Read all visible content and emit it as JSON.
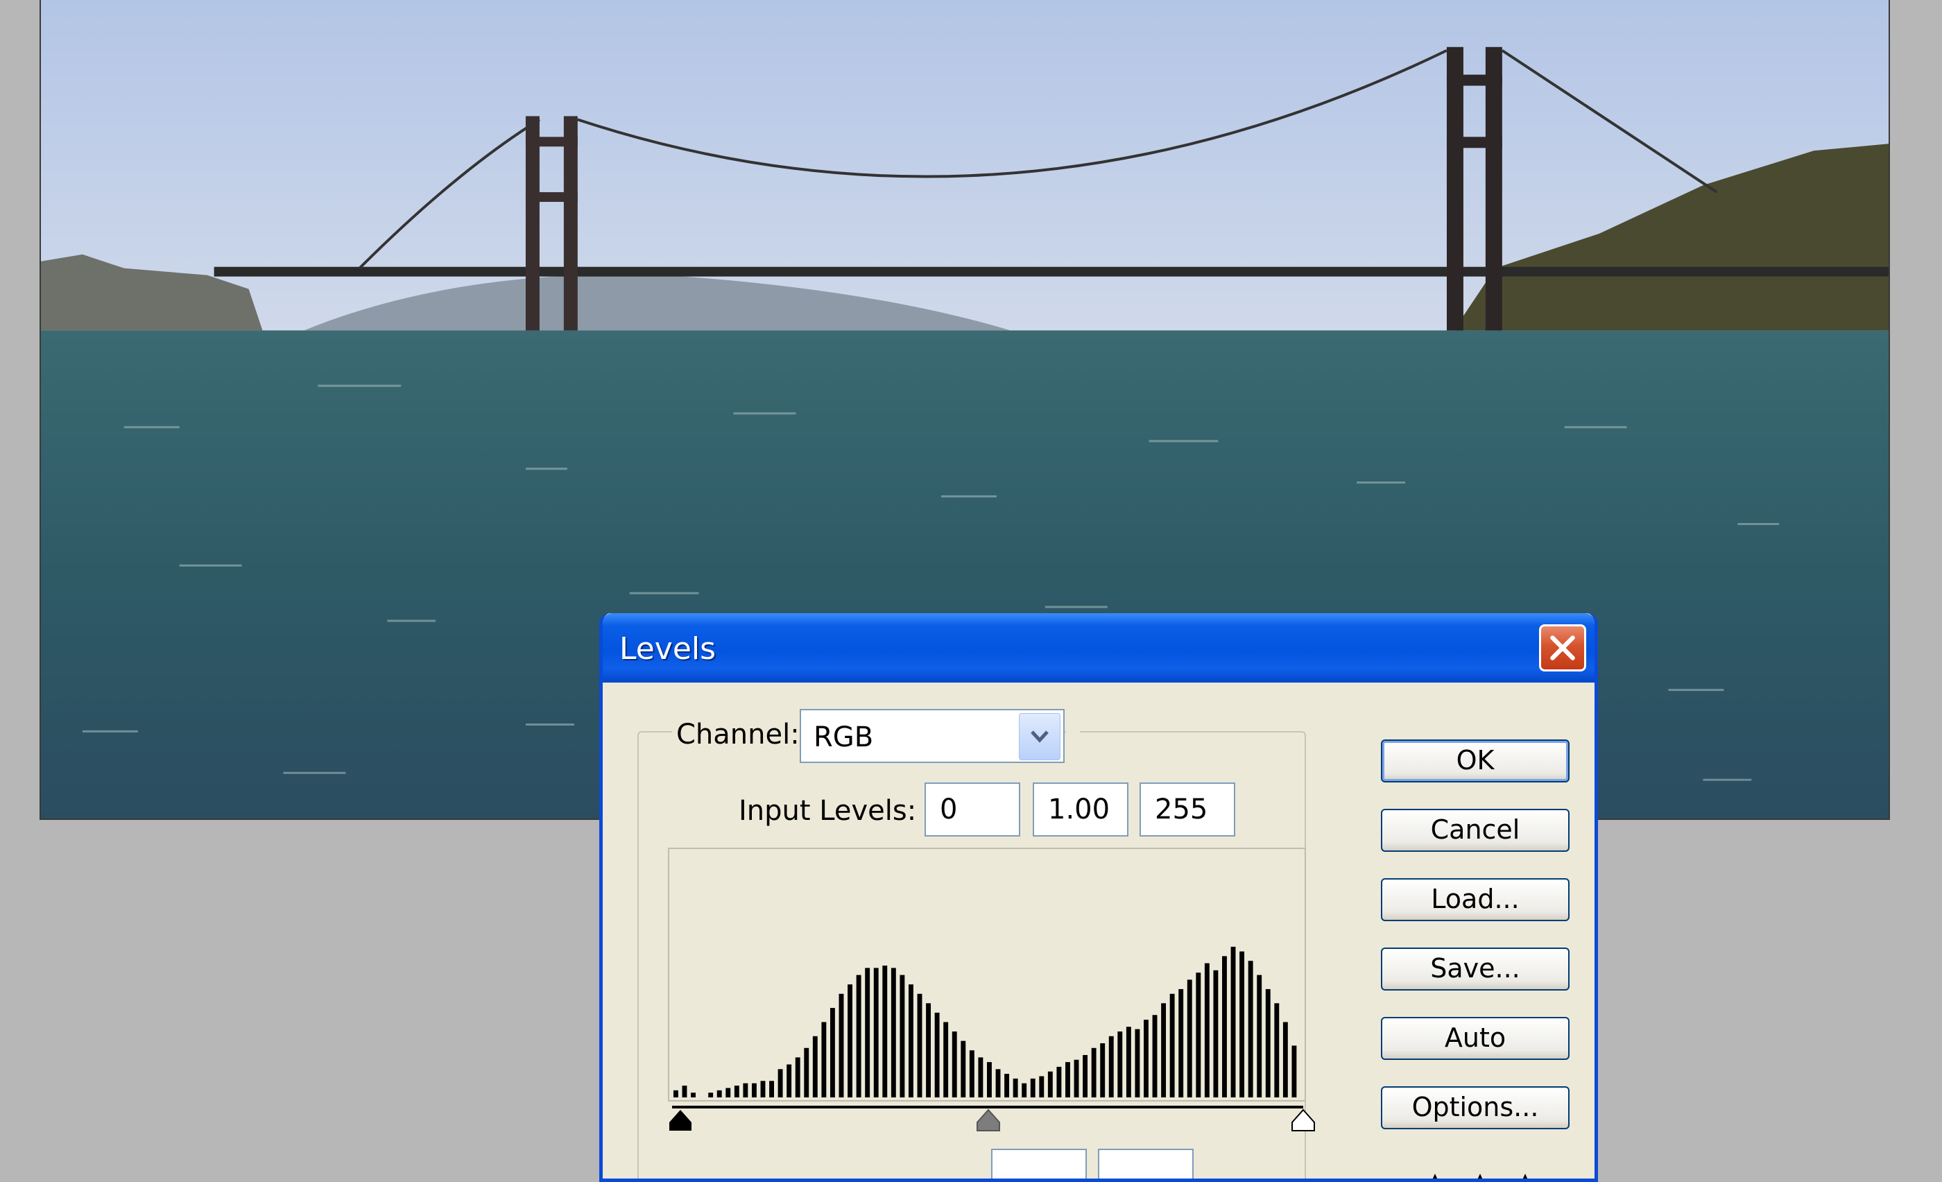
{
  "background_image": {
    "description_icon": "golden-gate-bridge-photo"
  },
  "dialog": {
    "title": "Levels",
    "channel": {
      "label": "Channel:",
      "value": "RGB"
    },
    "input_levels": {
      "label": "Input Levels:",
      "black": "0",
      "gamma": "1.00",
      "white": "255"
    },
    "buttons": {
      "ok": "OK",
      "cancel": "Cancel",
      "load": "Load...",
      "save": "Save...",
      "auto": "Auto",
      "options": "Options..."
    },
    "histogram": {
      "values": [
        3,
        5,
        2,
        0,
        2,
        3,
        4,
        5,
        6,
        6,
        7,
        7,
        12,
        14,
        17,
        21,
        26,
        32,
        38,
        44,
        48,
        52,
        55,
        55,
        56,
        55,
        52,
        48,
        44,
        40,
        36,
        32,
        28,
        24,
        20,
        17,
        15,
        12,
        10,
        8,
        6,
        8,
        9,
        11,
        13,
        15,
        16,
        18,
        21,
        23,
        26,
        28,
        30,
        29,
        33,
        35,
        40,
        44,
        46,
        50,
        53,
        57,
        54,
        60,
        64,
        62,
        58,
        52,
        46,
        40,
        32,
        22
      ],
      "sliders": {
        "black": 0,
        "gamma": 1.0,
        "white": 255
      }
    }
  },
  "colors": {
    "titlebar": "#0454e0",
    "dialog_bg": "#ece9d8",
    "close_button": "#d5532d"
  }
}
